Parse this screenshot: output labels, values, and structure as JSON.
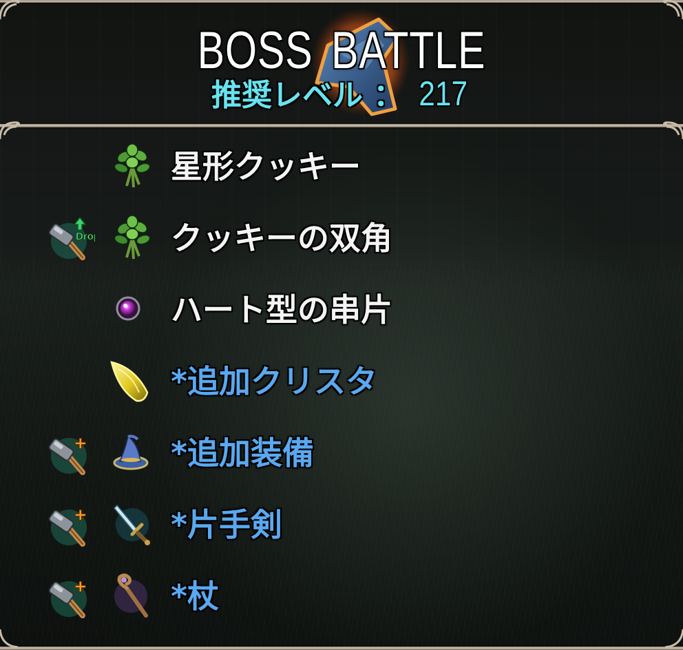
{
  "header": {
    "title_word1": "BOSS",
    "title_word2": "BATTLE",
    "level_label": "推奨レベル ：",
    "level_value": "217"
  },
  "drops": [
    {
      "name": "星形クッキー",
      "item_icon": "herb-bundle-icon",
      "smith_icon": null,
      "smith_badge": null,
      "color": "#f4f4f4"
    },
    {
      "name": "クッキーの双角",
      "item_icon": "herb-bundle-icon",
      "smith_icon": "smith-hammer-icon",
      "smith_badge": "Drop",
      "color": "#f4f4f4"
    },
    {
      "name": "ハート型の串片",
      "item_icon": "purple-orb-icon",
      "smith_icon": null,
      "smith_badge": null,
      "color": "#f4f4f4"
    },
    {
      "name": "*追加クリスタ",
      "item_icon": "yellow-crystal-icon",
      "smith_icon": null,
      "smith_badge": null,
      "color": "#5aa8f0"
    },
    {
      "name": "*追加装備",
      "item_icon": "wizard-hat-icon",
      "smith_icon": "smith-hammer-plus-icon",
      "smith_badge": "+",
      "color": "#5aa8f0"
    },
    {
      "name": "*片手剣",
      "item_icon": "one-handed-sword-icon",
      "smith_icon": "smith-hammer-plus-icon",
      "smith_badge": "+",
      "color": "#5aa8f0"
    },
    {
      "name": "*杖",
      "item_icon": "staff-icon",
      "smith_icon": "smith-hammer-plus-icon",
      "smith_badge": "+",
      "color": "#5aa8f0"
    }
  ],
  "colors": {
    "level_text": "#68e3f0",
    "item_text": "#f4f4f4",
    "extra_item_text": "#5aa8f0",
    "frame": "#d2c7b6"
  }
}
